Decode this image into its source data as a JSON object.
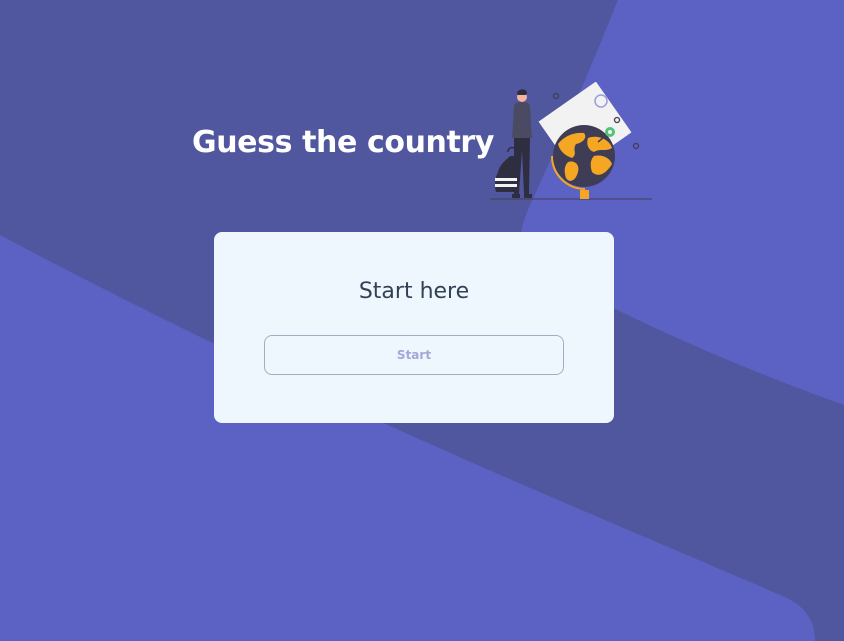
{
  "header": {
    "title": "Guess the country"
  },
  "card": {
    "heading": "Start here",
    "start_button_label": "Start"
  },
  "colors": {
    "background_light": "#5b62c3",
    "background_dark": "#50579f",
    "card_background": "#eff7fe",
    "title_text": "#ffffff",
    "heading_text": "#334155",
    "button_text": "#a2a8d8",
    "button_border": "#a3aec3",
    "globe_land": "#f5a623",
    "globe_ocean": "#3f3d56"
  },
  "illustration": {
    "icon": "traveler-with-globe-illustration"
  }
}
